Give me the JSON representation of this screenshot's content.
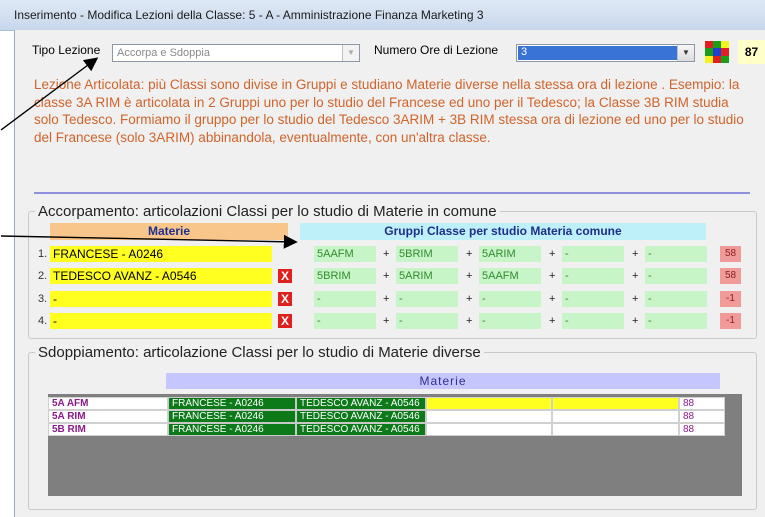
{
  "window": {
    "title": "Inserimento - Modifica Lezioni della Classe: 5 - A - Amministrazione Finanza Marketing 3"
  },
  "top": {
    "tipo_label": "Tipo Lezione",
    "tipo_value": "Accorpa e Sdoppia",
    "numero_label": "Numero  Ore di Lezione",
    "numero_value": "3",
    "counter": "87"
  },
  "description": "Lezione Articolata: più Classi sono divise in Gruppi e studiano Materie diverse nella stessa ora di lezione . Esempio: la classe 3A RIM è articolata in 2 Gruppi uno per lo studio del Francese ed uno per il Tedesco; la Classe 3B RIM studia solo Tedesco. Formiamo il gruppo per lo studio del Tedesco  3ARIM + 3B RIM  stessa ora di lezione ed uno per lo studio del Francese (solo 3ARIM) abbinandola, eventualmente,  con un'altra classe.",
  "accorpamento": {
    "title": "Accorpamento: articolazioni Classi per lo studio di Materie in comune",
    "col_materie": "Materie",
    "col_gruppi": "Gruppi Classe per studio Materia comune",
    "plus": "+",
    "rows": [
      {
        "num": "1.",
        "materia": "FRANCESE - A0246",
        "groups": [
          "5AAFM",
          "5BRIM",
          "5ARIM",
          "-",
          "-"
        ],
        "count": "58"
      },
      {
        "num": "2.",
        "materia": "TEDESCO AVANZ - A0546",
        "groups": [
          "5BRIM",
          "5ARIM",
          "5AAFM",
          "-",
          "-"
        ],
        "count": "58"
      },
      {
        "num": "3.",
        "materia": "-",
        "groups": [
          "-",
          "-",
          "-",
          "-",
          "-"
        ],
        "count": "-1"
      },
      {
        "num": "4.",
        "materia": "-",
        "groups": [
          "-",
          "-",
          "-",
          "-",
          "-"
        ],
        "count": "-1"
      }
    ],
    "delete_icon": "X"
  },
  "sdoppiamento": {
    "title": "Sdoppiamento: articolazione Classi per lo studio di Materie diverse",
    "materie_header": "Materie",
    "rows": [
      {
        "cls": "5A AFM",
        "m1": "FRANCESE - A0246",
        "m2": "TEDESCO AVANZ - A0546",
        "num": "88"
      },
      {
        "cls": "5A RIM",
        "m1": "FRANCESE - A0246",
        "m2": "TEDESCO AVANZ - A0546",
        "num": "88"
      },
      {
        "cls": "5B RIM",
        "m1": "FRANCESE - A0246",
        "m2": "TEDESCO AVANZ - A0546",
        "num": "88"
      }
    ]
  },
  "colors": {
    "description": "#d0642b",
    "subject": "#ffff20",
    "group": "#c8f5c8",
    "delete": "#e0201c",
    "grid_subject": "#0d7a1a"
  }
}
